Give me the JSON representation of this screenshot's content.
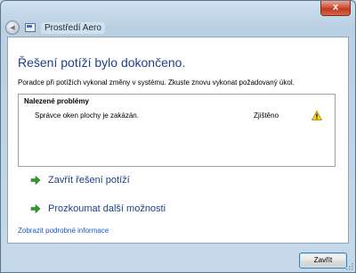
{
  "window": {
    "title": "Prostředí Aero",
    "close_glyph": "x",
    "back_glyph": "◀"
  },
  "content": {
    "heading": "Řešení potíží bylo dokončeno.",
    "description": "Poradce při potížích vykonal změny v systému. Zkuste znovu vykonat požadovaný úkol.",
    "problems": {
      "title": "Nalezené problémy",
      "rows": [
        {
          "name": "Správce oken plochy je zakázán.",
          "status": "Zjištěno",
          "icon": "warning-icon"
        }
      ]
    },
    "actions": [
      {
        "label": "Zavřít řešení potíží",
        "icon": "green-arrow-icon"
      },
      {
        "label": "Prozkoumat další možnosti",
        "icon": "green-arrow-icon"
      }
    ],
    "details_link": "Zobrazit podrobné informace"
  },
  "footer": {
    "close_button": "Zavřít"
  },
  "colors": {
    "heading": "#1e3f8a",
    "link": "#1a55c5",
    "arrow": "#2e9e2e",
    "warning": "#f4d21f"
  }
}
